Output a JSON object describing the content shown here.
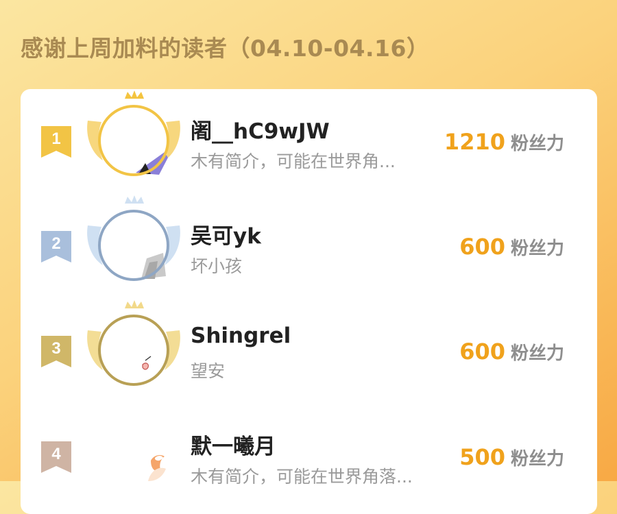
{
  "header": {
    "title": "感谢上周加料的读者（04.10-04.16）"
  },
  "colors": {
    "accent": "#f0a21c",
    "title": "#a98a52",
    "gold": "#f2c445",
    "silver": "#8ea6c4",
    "bronze": "#b8a055",
    "fourth": "#c8a898"
  },
  "leaderboard": [
    {
      "rank": "1",
      "name": "阇__hC9wJW",
      "bio": "木有简介，可能在世界角...",
      "score": "1210",
      "unit": "粉丝力",
      "frame": "gold-crown-frame-icon"
    },
    {
      "rank": "2",
      "name": "吴可yk",
      "bio": "坏小孩",
      "score": "600",
      "unit": "粉丝力",
      "frame": "silver-crown-frame-icon"
    },
    {
      "rank": "3",
      "name": "Shingrel",
      "bio": "望安",
      "score": "600",
      "unit": "粉丝力",
      "frame": "bronze-crown-frame-icon"
    },
    {
      "rank": "4",
      "name": "默一曦月",
      "bio": "木有简介，可能在世界角落...",
      "score": "500",
      "unit": "粉丝力",
      "frame": "none"
    }
  ]
}
